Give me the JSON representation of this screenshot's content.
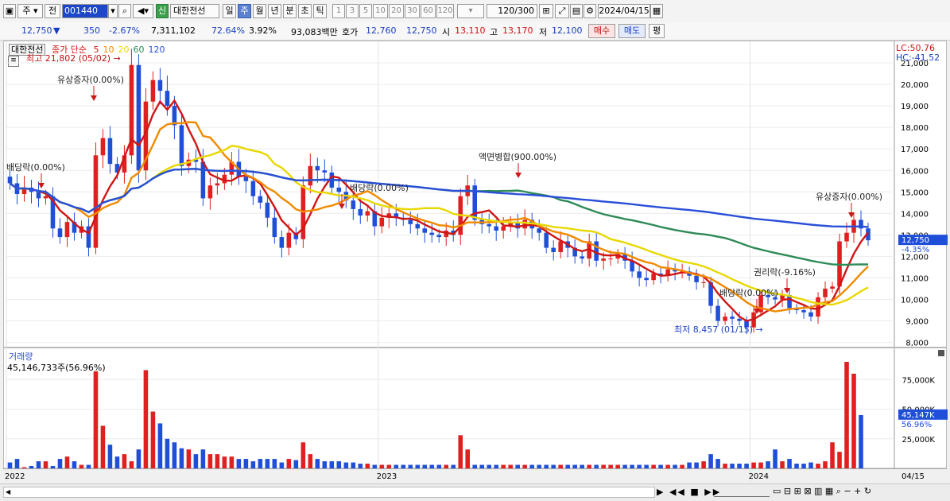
{
  "toolbar": {
    "type_label": "주",
    "type2_label": "전",
    "code": "001440",
    "stock_name": "대한전선",
    "badge": "신",
    "period_tabs": [
      "일",
      "주",
      "월",
      "년",
      "분",
      "초",
      "틱"
    ],
    "selected_period": "주",
    "interval_buttons": [
      "1",
      "3",
      "5",
      "10",
      "20",
      "30",
      "60",
      "120"
    ],
    "count": "120",
    "count_total": "/300",
    "date": "2024/04/15"
  },
  "quote": {
    "price": "12,750",
    "change_arrow": "▼",
    "change": "350",
    "change_rate": "-2.67%",
    "volume": "7,311,102",
    "vol_ratio": "72.64%",
    "turnover": "3.92%",
    "amount": "93,083백만",
    "hoga_label": "호가",
    "ask": "12,760",
    "bid": "12,750",
    "open_label": "시",
    "open": "13,110",
    "high_label": "고",
    "high": "13,170",
    "low_label": "저",
    "low": "12,100",
    "buy_button": "매수",
    "sell_button": "매도",
    "eval_button": "평"
  },
  "price_panel": {
    "stock_tag": "대한전선",
    "legend_close": "종가 단순",
    "ma_labels": [
      "5",
      "10",
      "20",
      "60",
      "120"
    ],
    "ma_colors": [
      "#d01515",
      "#f08a00",
      "#e8d800",
      "#2e8b57",
      "#2a4fd8"
    ],
    "lc": "LC:50.76",
    "hc": "HC:-41.52",
    "max_label": "최고 21,802 (05/02)",
    "min_label": "최저 8,457 (01/15)",
    "current_price_tag": "12,750",
    "current_pct_tag": "-4.35%",
    "annotations": [
      {
        "text": "유상증자(0.00%)"
      },
      {
        "text": "액면병합(900.00%)"
      },
      {
        "text": "유상증자(0.00%)"
      },
      {
        "text": "권리락(-9.16%)"
      },
      {
        "text": "배당락(0.00%)"
      },
      {
        "text": "배당락(0.00%)"
      },
      {
        "text": "배당락(0.00%)"
      }
    ]
  },
  "volume_panel": {
    "title": "거래량",
    "value_label": "45,146,733주(56.96%)",
    "current_tag": "45,147K",
    "current_pct_tag": "56.96%"
  },
  "x_axis": {
    "ticks": [
      "2022",
      "2023",
      "2024"
    ],
    "end_label": "04/15"
  },
  "chart_data": {
    "type": "candlestick",
    "title": "대한전선 주봉",
    "price_axis": {
      "ylim": [
        7800,
        22000
      ],
      "ticks": [
        8000,
        9000,
        10000,
        11000,
        12000,
        13000,
        14000,
        15000,
        16000,
        17000,
        18000,
        19000,
        20000,
        21000
      ],
      "tick_labels": [
        "8,000",
        "9,000",
        "10,000",
        "11,000",
        "12,000",
        "13,000",
        "14,000",
        "15,000",
        "16,000",
        "17,000",
        "18,000",
        "19,000",
        "20,000",
        "21,000"
      ]
    },
    "volume_axis": {
      "ylim": [
        0,
        90000000
      ],
      "ticks": [
        25000000,
        50000000,
        75000000
      ],
      "tick_labels": [
        "25,000K",
        "50,000K",
        "75,000K"
      ]
    },
    "weeks_count": 121,
    "year_starts": {
      "2022": 0,
      "2023": 52,
      "2024": 104
    },
    "close": [
      15400,
      14900,
      15200,
      15000,
      14700,
      14800,
      13300,
      12900,
      13600,
      13100,
      13400,
      12400,
      16700,
      17500,
      16300,
      15900,
      16700,
      20900,
      16000,
      19200,
      20200,
      19700,
      19000,
      18100,
      16200,
      16500,
      16400,
      14700,
      15300,
      15400,
      15800,
      16400,
      15700,
      15500,
      14800,
      14500,
      13800,
      12900,
      12400,
      13100,
      12800,
      15300,
      16200,
      16000,
      15900,
      15200,
      15000,
      14600,
      14200,
      13900,
      14100,
      13400,
      13800,
      14000,
      13800,
      13700,
      13500,
      13300,
      13100,
      13000,
      12900,
      13200,
      13000,
      14800,
      15300,
      13700,
      13500,
      13400,
      13200,
      13400,
      13600,
      13300,
      13700,
      13300,
      13100,
      12400,
      12200,
      12700,
      12400,
      12000,
      11900,
      12700,
      11800,
      11900,
      11900,
      12100,
      11800,
      11300,
      11000,
      10900,
      11200,
      11100,
      11400,
      11300,
      11300,
      11100,
      10800,
      10800,
      9700,
      9000,
      9200,
      9100,
      9000,
      8700,
      9400,
      10200,
      10100,
      10000,
      10200,
      9600,
      9500,
      9400,
      9200,
      10100,
      10500,
      10600,
      12700,
      13100,
      13700,
      13300,
      12750
    ],
    "volume_millions": [
      5,
      8,
      1,
      2,
      6,
      6,
      2,
      8,
      10,
      6,
      3,
      3,
      82,
      36,
      20,
      10,
      12,
      6,
      16,
      83,
      48,
      38,
      25,
      22,
      17,
      16,
      12,
      16,
      12,
      12,
      10,
      10,
      8,
      8,
      6,
      8,
      8,
      8,
      5,
      8,
      7,
      22,
      12,
      8,
      6,
      6,
      6,
      5,
      5,
      4,
      4,
      3,
      3,
      3,
      3,
      3,
      3,
      3,
      3,
      3,
      3,
      3,
      3,
      28,
      16,
      3,
      3,
      3,
      3,
      3,
      3,
      3,
      3,
      3,
      3,
      3,
      3,
      3,
      3,
      3,
      3,
      3,
      3,
      3,
      3,
      3,
      3,
      3,
      3,
      3,
      3,
      3,
      3,
      3,
      3,
      5,
      5,
      6,
      12,
      8,
      4,
      4,
      4,
      4,
      5,
      5,
      6,
      16,
      6,
      8,
      4,
      4,
      5,
      4,
      6,
      22,
      14,
      90,
      80,
      45
    ]
  }
}
